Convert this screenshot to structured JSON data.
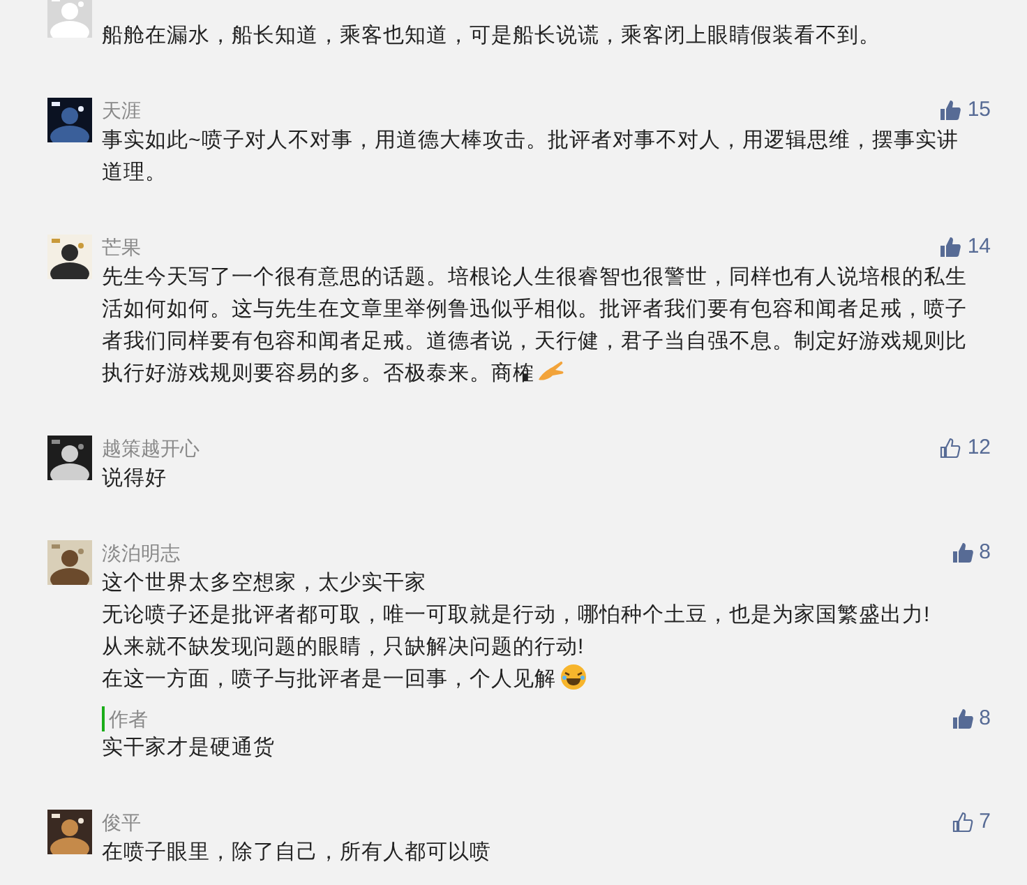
{
  "comments": [
    {
      "lines": [
        "船舱在漏水，船长知道，乘客也知道，可是船长说谎，乘客闭上眼睛假装看不到。"
      ]
    },
    {
      "name": "天涯",
      "likes": "15",
      "liked": true,
      "lines": [
        "事实如此~喷子对人不对事，用道德大棒攻击。批评者对事不对人，用逻辑思维，摆事实讲道理。"
      ]
    },
    {
      "name": "芒果",
      "likes": "14",
      "liked": true,
      "lines": [
        "先生今天写了一个很有意思的话题。培根论人生很睿智也很警世，同样也有人说培根的私生活如何如何。这与先生在文章里举例鲁迅似乎相似。批评者我们要有包容和闻者足戒，喷子者我们同样要有包容和闻者足戒。道德者说，天行健，君子当自强不息。制定好游戏规则比执行好游戏规则要容易的多。否极泰来。商榷"
      ],
      "emoji": {
        "kind": "hand"
      }
    },
    {
      "name": "越策越开心",
      "likes": "12",
      "liked": false,
      "lines": [
        "说得好"
      ]
    },
    {
      "name": "淡泊明志",
      "likes": "8",
      "liked": true,
      "lines": [
        "这个世界太多空想家，太少实干家",
        "无论喷子还是批评者都可取，唯一可取就是行动，哪怕种个土豆，也是为家国繁盛出力!",
        "从来就不缺发现问题的眼睛，只缺解决问题的行动!",
        "在这一方面，喷子与批评者是一回事，个人见解"
      ],
      "emoji": {
        "kind": "laugh"
      },
      "reply": {
        "name": "作者",
        "likes": "8",
        "liked": true,
        "lines": [
          "实干家才是硬通货"
        ]
      }
    },
    {
      "name": "俊平",
      "likes": "7",
      "liked": false,
      "lines": [
        "在喷子眼里，除了自己，所有人都可以喷"
      ]
    }
  ]
}
